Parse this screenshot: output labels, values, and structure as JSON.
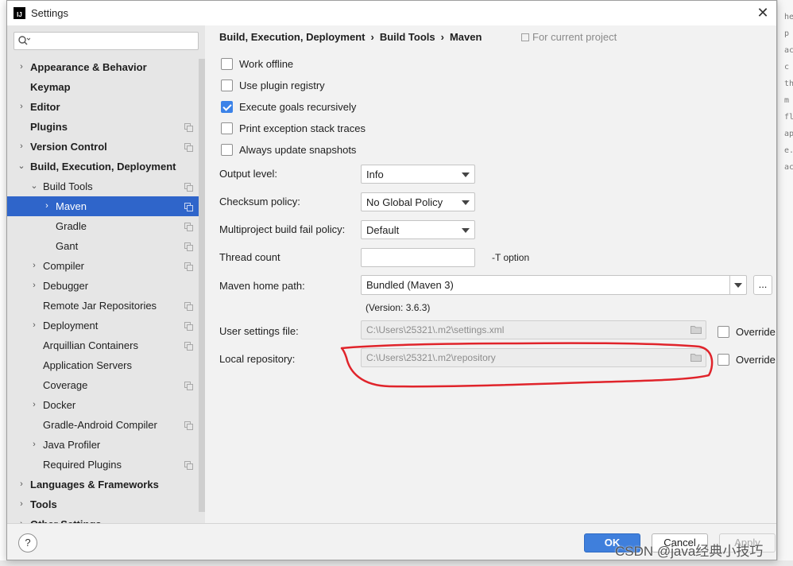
{
  "window": {
    "title": "Settings",
    "app_icon": "intellij-icon",
    "close_label": "✕"
  },
  "search": {
    "placeholder": "",
    "value": ""
  },
  "sidebar": {
    "items": [
      {
        "label": "Appearance & Behavior",
        "bold": true,
        "arrow": "›",
        "has_copy": false
      },
      {
        "label": "Keymap",
        "bold": true,
        "arrow": "",
        "has_copy": false
      },
      {
        "label": "Editor",
        "bold": true,
        "arrow": "›",
        "has_copy": false
      },
      {
        "label": "Plugins",
        "bold": true,
        "arrow": "",
        "has_copy": true
      },
      {
        "label": "Version Control",
        "bold": true,
        "arrow": "›",
        "has_copy": true
      },
      {
        "label": "Build, Execution, Deployment",
        "bold": true,
        "arrow": "⌄",
        "has_copy": false
      },
      {
        "label": "Build Tools",
        "bold": false,
        "arrow": "⌄",
        "has_copy": true
      },
      {
        "label": "Maven",
        "bold": false,
        "arrow": "›",
        "has_copy": true,
        "selected": true
      },
      {
        "label": "Gradle",
        "bold": false,
        "arrow": "",
        "has_copy": true
      },
      {
        "label": "Gant",
        "bold": false,
        "arrow": "",
        "has_copy": true
      },
      {
        "label": "Compiler",
        "bold": false,
        "arrow": "›",
        "has_copy": true
      },
      {
        "label": "Debugger",
        "bold": false,
        "arrow": "›",
        "has_copy": false
      },
      {
        "label": "Remote Jar Repositories",
        "bold": false,
        "arrow": "",
        "has_copy": true
      },
      {
        "label": "Deployment",
        "bold": false,
        "arrow": "›",
        "has_copy": true
      },
      {
        "label": "Arquillian Containers",
        "bold": false,
        "arrow": "",
        "has_copy": true
      },
      {
        "label": "Application Servers",
        "bold": false,
        "arrow": "",
        "has_copy": false
      },
      {
        "label": "Coverage",
        "bold": false,
        "arrow": "",
        "has_copy": true
      },
      {
        "label": "Docker",
        "bold": false,
        "arrow": "›",
        "has_copy": false
      },
      {
        "label": "Gradle-Android Compiler",
        "bold": false,
        "arrow": "",
        "has_copy": true
      },
      {
        "label": "Java Profiler",
        "bold": false,
        "arrow": "›",
        "has_copy": false
      },
      {
        "label": "Required Plugins",
        "bold": false,
        "arrow": "",
        "has_copy": true
      },
      {
        "label": "Languages & Frameworks",
        "bold": true,
        "arrow": "›",
        "has_copy": false
      },
      {
        "label": "Tools",
        "bold": true,
        "arrow": "›",
        "has_copy": false
      },
      {
        "label": "Other Settings",
        "bold": true,
        "arrow": "›",
        "has_copy": false
      }
    ]
  },
  "breadcrumb": {
    "parts": [
      "Build, Execution, Deployment",
      "Build Tools",
      "Maven"
    ],
    "separator": "›",
    "scope": "For current project"
  },
  "options": {
    "work_offline": {
      "label": "Work offline",
      "checked": false
    },
    "use_plugin_registry": {
      "label": "Use plugin registry",
      "checked": false
    },
    "execute_goals_recursively": {
      "label": "Execute goals recursively",
      "checked": true
    },
    "print_exception_stack_traces": {
      "label": "Print exception stack traces",
      "checked": false
    },
    "always_update_snapshots": {
      "label": "Always update snapshots",
      "checked": false
    }
  },
  "fields": {
    "output_level": {
      "label": "Output level:",
      "value": "Info"
    },
    "checksum_policy": {
      "label": "Checksum policy:",
      "value": "No Global Policy"
    },
    "multiproject_fail_policy": {
      "label": "Multiproject build fail policy:",
      "value": "Default"
    },
    "thread_count": {
      "label": "Thread count",
      "value": "",
      "hint": "-T option"
    },
    "maven_home": {
      "label": "Maven home path:",
      "value": "Bundled (Maven 3)",
      "browse": "...",
      "version": "(Version: 3.6.3)"
    },
    "user_settings": {
      "label": "User settings file:",
      "value": "C:\\Users\\25321\\.m2\\settings.xml",
      "override_label": "Override",
      "override_checked": false
    },
    "local_repository": {
      "label": "Local repository:",
      "value": "C:\\Users\\25321\\.m2\\repository",
      "override_label": "Override",
      "override_checked": false
    }
  },
  "annotation_color": "#e0242b",
  "buttons": {
    "help": "?",
    "ok": "OK",
    "cancel": "Cancel",
    "apply": "Apply"
  },
  "watermark": "CSDN @java经典小技巧",
  "background_editor_lines": [
    "he",
    "p",
    "ac",
    "c",
    "th",
    "m",
    "fl",
    "ap",
    "e.",
    "ac"
  ]
}
